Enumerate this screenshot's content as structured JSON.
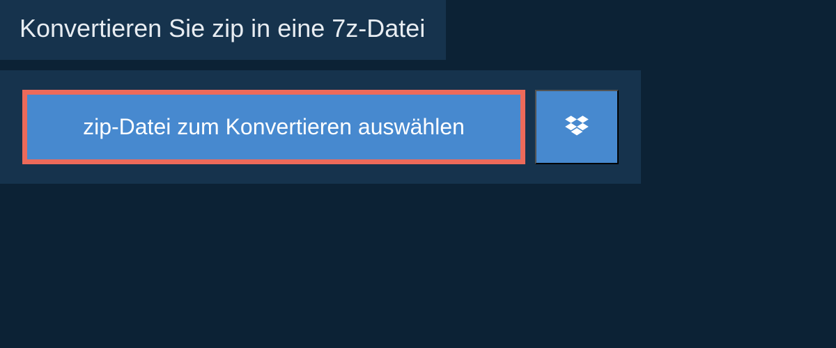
{
  "header": {
    "title": "Konvertieren Sie zip in eine 7z-Datei"
  },
  "actions": {
    "select_file_label": "zip-Datei zum Konvertieren auswählen"
  },
  "colors": {
    "background_dark": "#0c2235",
    "panel": "#16334d",
    "button_blue": "#4789cf",
    "button_border": "#ed6a5a"
  }
}
